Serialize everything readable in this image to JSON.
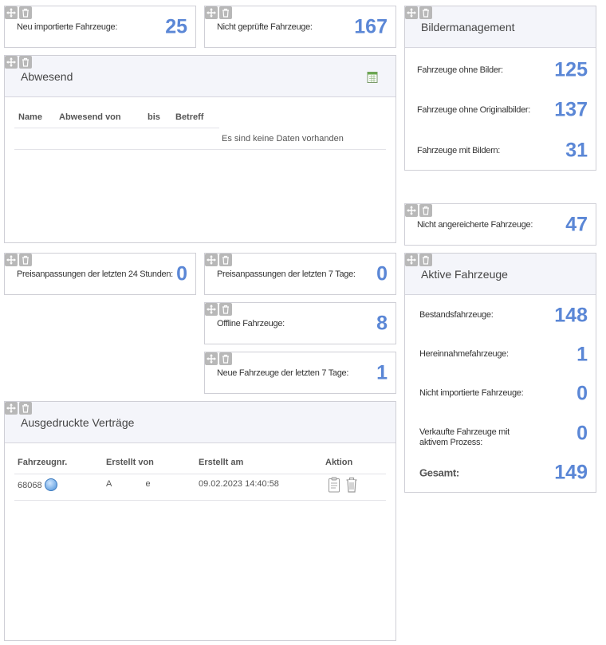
{
  "kpi": {
    "neu_importiert": {
      "label": "Neu importierte Fahrzeuge:",
      "value": "25"
    },
    "nicht_geprueft": {
      "label": "Nicht geprüfte Fahrzeuge:",
      "value": "167"
    },
    "preis_24h": {
      "label": "Preisanpassungen der letzten 24 Stunden:",
      "value": "0"
    },
    "preis_7t": {
      "label": "Preisanpassungen der letzten 7 Tage:",
      "value": "0"
    },
    "offline": {
      "label": "Offline Fahrzeuge:",
      "value": "8"
    },
    "neue_7t": {
      "label": "Neue Fahrzeuge der letzten 7 Tage:",
      "value": "1"
    },
    "nicht_angereichert": {
      "label": "Nicht angereicherte Fahrzeuge:",
      "value": "47"
    }
  },
  "abwesend": {
    "title": "Abwesend",
    "columns": [
      "Name",
      "Abwesend von",
      "bis",
      "Betreff"
    ],
    "empty_text": "Es sind keine Daten vorhanden"
  },
  "bilder": {
    "title": "Bildermanagement",
    "rows": [
      {
        "label": "Fahrzeuge ohne Bilder:",
        "value": "125"
      },
      {
        "label": "Fahrzeuge ohne Originalbilder:",
        "value": "137"
      },
      {
        "label": "Fahrzeuge mit Bildern:",
        "value": "31"
      }
    ]
  },
  "aktiv": {
    "title": "Aktive Fahrzeuge",
    "rows": [
      {
        "label": "Bestandsfahrzeuge:",
        "value": "148"
      },
      {
        "label": "Hereinnahmefahrzeuge:",
        "value": "1"
      },
      {
        "label": "Nicht importierte Fahrzeuge:",
        "value": "0"
      },
      {
        "label": "Verkaufte Fahrzeuge mit",
        "label2": "aktivem Prozess:",
        "value": "0"
      },
      {
        "label": "Gesamt:",
        "value": "149"
      }
    ]
  },
  "vertraege": {
    "title": "Ausgedruckte Verträge",
    "columns": [
      "Fahrzeugnr.",
      "Erstellt von",
      "Erstellt am",
      "Aktion"
    ],
    "rows": [
      {
        "fahrzeugnr": "68068",
        "erstellt_von": "A              e",
        "erstellt_am": "09.02.2023 14:40:58"
      }
    ]
  },
  "icons": {
    "move": "move-icon",
    "delete": "trash-icon",
    "export": "excel-export-icon",
    "help": "help-icon",
    "contract": "clipboard-icon"
  },
  "colors": {
    "accent": "#5b87d6",
    "header_bg": "#f4f5fa",
    "tool_bg": "#b8b8b8"
  }
}
